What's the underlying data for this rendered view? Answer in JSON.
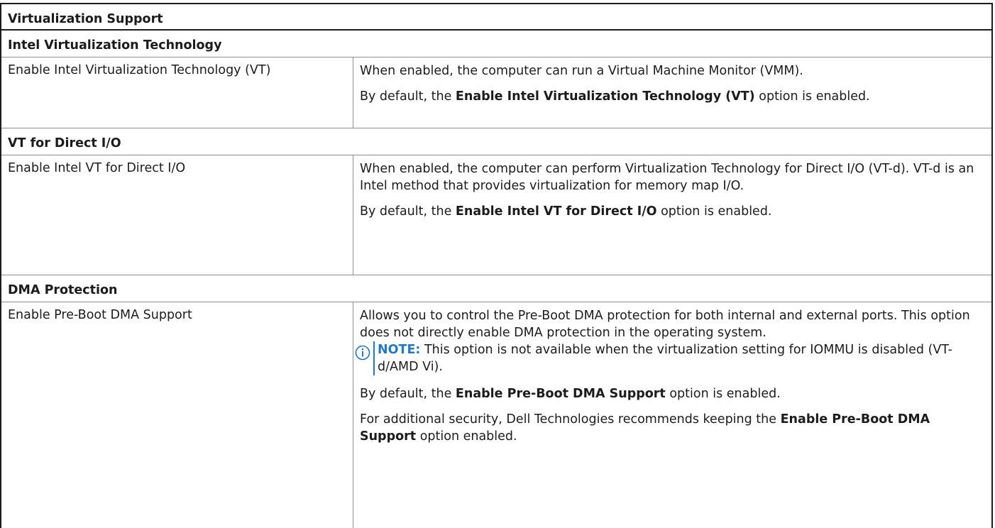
{
  "title": "Virtualization Support",
  "accent_color": "#1f78c8",
  "sections": [
    {
      "heading": "Intel Virtualization Technology",
      "option": "Enable Intel Virtualization Technology (VT)",
      "desc": "When enabled, the computer can run a Virtual Machine Monitor (VMM).",
      "default_pre": "By default, the ",
      "default_option": "Enable Intel Virtualization Technology (VT)",
      "default_post": " option is enabled."
    },
    {
      "heading": "VT for Direct I/O",
      "option": "Enable Intel VT for Direct I/O",
      "desc": "When enabled, the computer can perform Virtualization Technology for Direct I/O (VT-d). VT-d is an Intel method that provides virtualization for memory map I/O.",
      "default_pre": "By default, the ",
      "default_option": "Enable Intel VT for Direct I/O",
      "default_post": " option is enabled."
    },
    {
      "heading": "DMA Protection",
      "option": "Enable Pre-Boot DMA Support",
      "desc": "Allows you to control the Pre-Boot DMA protection for both internal and external ports. This option does not directly enable DMA protection in the operating system.",
      "note_icon": "info-icon",
      "note_label": "NOTE:",
      "note_text": " This option is not available when the virtualization setting for IOMMU is disabled (VT-d/AMD Vi).",
      "default_pre": "By default, the ",
      "default_option": "Enable Pre-Boot DMA Support",
      "default_post": " option is enabled.",
      "extra_pre": "For additional security, Dell Technologies recommends keeping the ",
      "extra_option": "Enable Pre-Boot DMA Support",
      "extra_post": " option enabled."
    }
  ]
}
